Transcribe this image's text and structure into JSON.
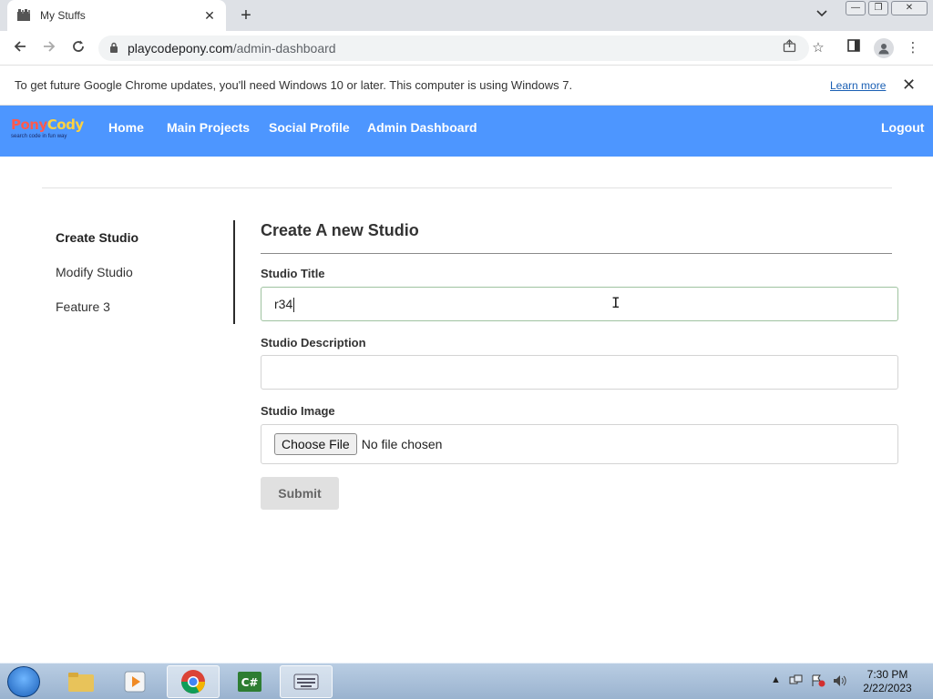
{
  "browser": {
    "tab_title": "My Stuffs",
    "tab_close": "✕",
    "new_tab": "+",
    "url_host": "playcodepony.com",
    "url_path": "/admin-dashboard"
  },
  "infobar": {
    "message": "To get future Google Chrome updates, you'll need Windows 10 or later. This computer is using Windows 7.",
    "learn_more": "Learn more",
    "close": "✕"
  },
  "site": {
    "logo_text": "PonyCody",
    "logo_tagline": "search code in fun way",
    "nav": [
      "Home",
      "Main Projects",
      "Social Profile",
      "Admin Dashboard"
    ],
    "logout": "Logout"
  },
  "sidebar": {
    "items": [
      "Create Studio",
      "Modify Studio",
      "Feature 3"
    ],
    "active_index": 0
  },
  "form": {
    "heading": "Create A new Studio",
    "title_label": "Studio Title",
    "title_value": "r34",
    "description_label": "Studio Description",
    "description_value": "",
    "image_label": "Studio Image",
    "choose_file": "Choose File",
    "no_file": "No file chosen",
    "submit": "Submit"
  },
  "taskbar": {
    "time": "7:30 PM",
    "date": "2/22/2023",
    "apps": [
      "file-explorer-icon",
      "media-player-icon",
      "chrome-icon",
      "csharp-icon",
      "keyboard-app-icon"
    ]
  },
  "colors": {
    "nav_bg": "#4d96ff",
    "link": "#1a5fb4"
  }
}
